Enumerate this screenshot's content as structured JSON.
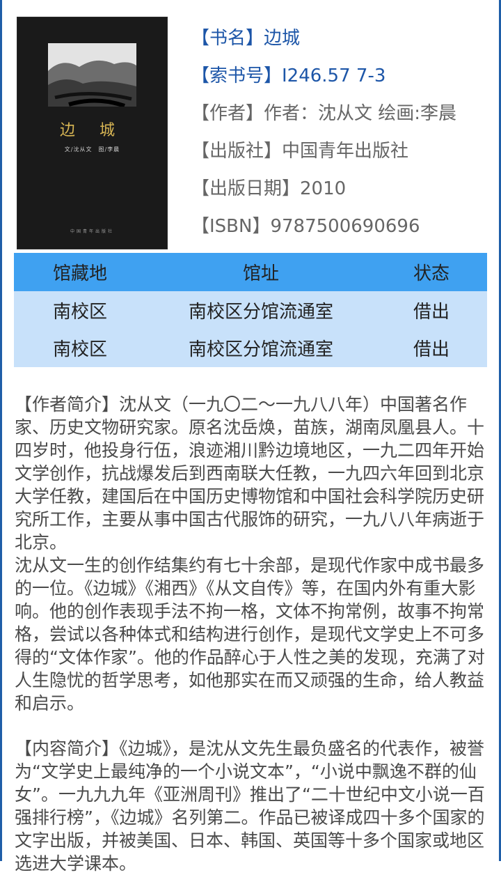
{
  "cover": {
    "title": "边 城",
    "credit": "文/沈从文　图/李晨",
    "publisher": "中国青年出版社"
  },
  "meta": {
    "title": "【书名】边城",
    "call_number": "【索书号】I246.57 7-3",
    "author": "【作者】作者：沈从文 绘画:李晨",
    "publisher": "【出版社】中国青年出版社",
    "pub_date": "【出版日期】2010",
    "isbn": "【ISBN】9787500690696"
  },
  "holdings": {
    "headers": [
      "馆藏地",
      "馆址",
      "状态"
    ],
    "rows": [
      [
        "南校区",
        "南校区分馆流通室",
        "借出"
      ],
      [
        "南校区",
        "南校区分馆流通室",
        "借出"
      ]
    ]
  },
  "author_intro": {
    "p1": "【作者简介】沈从文（一九〇二～一九八八年）中国著名作家、历史文物研究家。原名沈岳焕，苗族，湖南凤凰县人。十四岁时，他投身行伍，浪迹湘川黔边境地区，一九二四年开始文学创作，抗战爆发后到西南联大任教，一九四六年回到北京大学任教，建国后在中国历史博物馆和中国社会科学院历史研究所工作，主要从事中国古代服饰的研究，一九八八年病逝于北京。",
    "p2": "沈从文一生的创作结集约有七十余部，是现代作家中成书最多的一位。《边城》《湘西》《从文自传》等，在国内外有重大影响。他的创作表现手法不拘一格，文体不拘常例，故事不拘常格，尝试以各种体式和结构进行创作，是现代文学史上不可多得的“文体作家”。他的作品醉心于人性之美的发现，充满了对人生隐忧的哲学思考，如他那实在而又顽强的生命，给人教益和启示。"
  },
  "content_intro": {
    "p1": "【内容简介】《边城》，是沈从文先生最负盛名的代表作，被誉为“文学史上最纯净的一个小说文本”，“小说中飘逸不群的仙女”。一九九九年《亚洲周刊》推出了“二十世纪中文小说一百强排行榜”，《边城》名列第二。作品已被译成四十多个国家的文字出版，并被美国、日本、韩国、英国等十多个国家或地区选进大学课本。"
  },
  "colors": {
    "accent_text": "#1d56a8",
    "table_header": "#3fa1f1",
    "table_body": "#c8e1fa",
    "cover_title": "#d8b654"
  }
}
